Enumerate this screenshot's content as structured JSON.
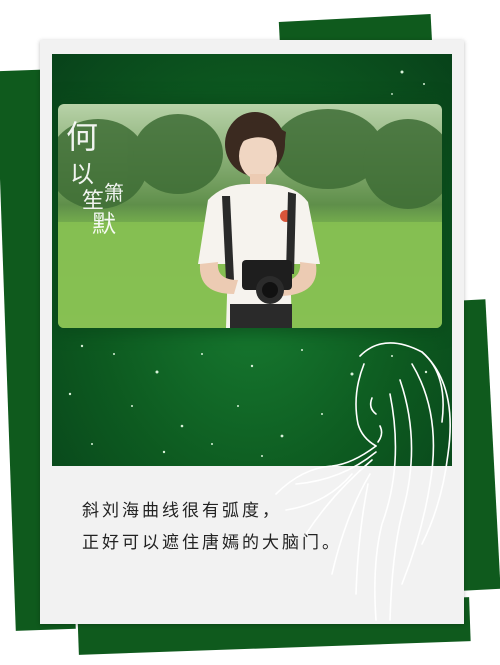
{
  "caption": {
    "line1": "斜刘海曲线很有弧度，",
    "line2": "正好可以遮住唐嫣的大脑门。"
  },
  "title_logo_text": "何以笙箫默",
  "colors": {
    "card_green": "#0f5a1d",
    "panel_green": "#0d5a20",
    "paper": "#f2f2f2"
  },
  "icons": [
    "girl-line-sketch",
    "sparkle-stars"
  ]
}
